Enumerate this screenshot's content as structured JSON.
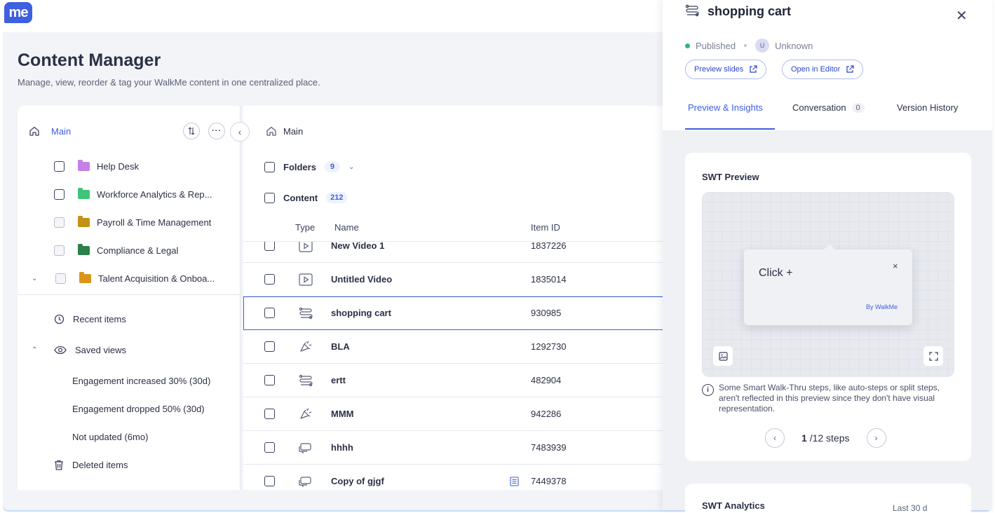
{
  "app": {
    "logo_text": "me"
  },
  "page": {
    "title": "Content Manager",
    "subtitle": "Manage, view, reorder & tag your WalkMe content in one centralized place."
  },
  "sidebar": {
    "root_label": "Main",
    "folders": [
      {
        "label": "Help Desk",
        "color": "#c57fe6",
        "checkbox_style": "dark"
      },
      {
        "label": "Workforce Analytics & Rep...",
        "color": "#3fc47a",
        "checkbox_style": "dark"
      },
      {
        "label": "Payroll & Time Management",
        "color": "#c39216",
        "checkbox_style": "light"
      },
      {
        "label": "Compliance & Legal",
        "color": "#2b7f4a",
        "checkbox_style": "light"
      },
      {
        "label": "Talent Acquisition & Onboa...",
        "color": "#d9951a",
        "checkbox_style": "light"
      }
    ],
    "recent_items": "Recent items",
    "saved_views": "Saved views",
    "views": [
      "Engagement increased 30% (30d)",
      "Engagement dropped 50% (30d)",
      "Not updated (6mo)"
    ],
    "deleted_items": "Deleted items"
  },
  "main": {
    "breadcrumb": "Main",
    "folders_label": "Folders",
    "folders_count": "9",
    "content_label": "Content",
    "content_count": "212",
    "columns": {
      "type": "Type",
      "name": "Name",
      "item_id": "Item ID"
    },
    "rows": [
      {
        "type": "video",
        "name": "New Video 1",
        "item_id": "1837226",
        "selected": false
      },
      {
        "type": "video",
        "name": "Untitled Video",
        "item_id": "1835014",
        "selected": false
      },
      {
        "type": "smart-walkthru",
        "name": "shopping cart",
        "item_id": "930985",
        "selected": true
      },
      {
        "type": "launcher",
        "name": "BLA",
        "item_id": "1292730",
        "selected": false
      },
      {
        "type": "smart-walkthru",
        "name": "ertt",
        "item_id": "482904",
        "selected": false
      },
      {
        "type": "launcher",
        "name": "MMM",
        "item_id": "942286",
        "selected": false
      },
      {
        "type": "shoutout",
        "name": "hhhh",
        "item_id": "7483939",
        "selected": false
      },
      {
        "type": "shoutout",
        "name": "Copy of gjgf",
        "item_id": "7449378",
        "selected": false
      }
    ]
  },
  "panel": {
    "title": "shopping cart",
    "status": "Published",
    "owner_initial": "U",
    "owner": "Unknown",
    "preview_button": "Preview slides",
    "editor_button": "Open in Editor",
    "tabs": {
      "insights": "Preview & Insights",
      "conversation": "Conversation",
      "conversation_count": "0",
      "history": "Version History"
    },
    "preview_title": "SWT Preview",
    "balloon_text": "Click +",
    "balloon_close": "×",
    "balloon_brand": "By WalkMe",
    "info_text": "Some Smart Walk-Thru steps, like auto-steps or split steps, aren't reflected in this preview since they don't have visual representation.",
    "step_current": "1",
    "step_total": "/12 steps",
    "analytics_title": "SWT Analytics",
    "analytics_range": "Last 30 d"
  }
}
